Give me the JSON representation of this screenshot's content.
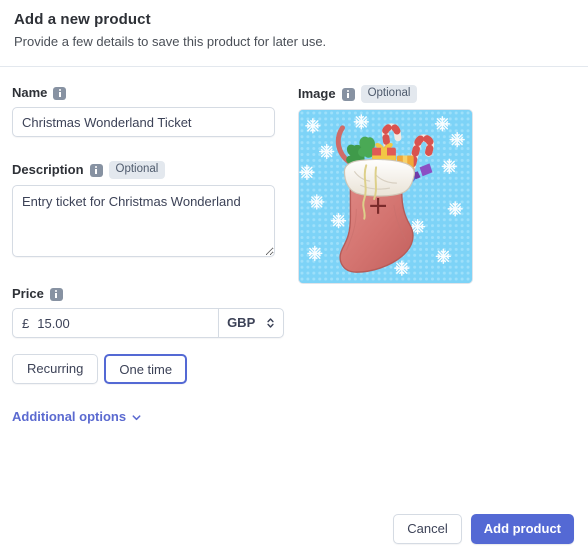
{
  "header": {
    "title": "Add a new product",
    "subtitle": "Provide a few details to save this product for later use."
  },
  "form": {
    "name": {
      "label": "Name",
      "info_icon": "info-icon",
      "value": "Christmas Wonderland Ticket",
      "placeholder": ""
    },
    "description": {
      "label": "Description",
      "info_icon": "info-icon",
      "optional_badge": "Optional",
      "value": "Entry ticket for Christmas Wonderland",
      "placeholder": ""
    },
    "price": {
      "label": "Price",
      "info_icon": "info-icon",
      "currency_symbol": "£",
      "value": "15.00",
      "placeholder": "0.00",
      "currency_code": "GBP",
      "currency_options": [
        "GBP"
      ],
      "select_icon": "chevron-up-down-icon"
    },
    "billing": {
      "recurring_label": "Recurring",
      "one_time_label": "One time",
      "selected": "One time"
    },
    "additional_options": {
      "label": "Additional options",
      "icon": "chevron-down-icon"
    },
    "image": {
      "label": "Image",
      "info_icon": "info-icon",
      "optional_badge": "Optional",
      "alt": "Christmas stocking filled with gifts and candy canes on a snowflake background"
    }
  },
  "footer": {
    "cancel_label": "Cancel",
    "submit_label": "Add product"
  },
  "colors": {
    "accent": "#5469d4",
    "link": "#5b6ad0",
    "text": "#3c4257",
    "heading": "#2e3137",
    "border": "#d5dbe3",
    "divider": "#e3e8ee",
    "badge_bg": "#e3e8ee",
    "info_icon": "#8792a2",
    "image_bg": "#7dd3f7",
    "stocking_red": "#d4736f",
    "stocking_cuff": "#f7f3ea"
  }
}
